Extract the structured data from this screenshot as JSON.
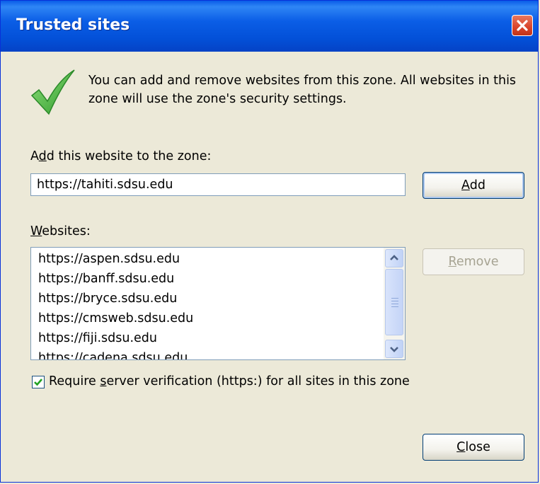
{
  "window": {
    "title": "Trusted sites"
  },
  "description": "You can add and remove websites from this zone. All websites in this zone will use the zone's security settings.",
  "add_section": {
    "label_pre": "A",
    "label_accel": "d",
    "label_post": "d this website to the zone:",
    "input_value": "https://tahiti.sdsu.edu",
    "add_button_accel": "A",
    "add_button_rest": "dd"
  },
  "websites_section": {
    "label_accel": "W",
    "label_rest": "ebsites:",
    "items": [
      "https://aspen.sdsu.edu",
      "https://banff.sdsu.edu",
      "https://bryce.sdsu.edu",
      "https://cmsweb.sdsu.edu",
      "https://fiji.sdsu.edu",
      "https://cadena.sdsu.edu"
    ],
    "remove_button_accel": "R",
    "remove_button_rest": "emove"
  },
  "verification": {
    "checked": true,
    "label_pre": "Require ",
    "label_accel": "s",
    "label_post": "erver verification (https:) for all sites in this zone"
  },
  "footer": {
    "close_button_accel": "C",
    "close_button_rest": "lose"
  },
  "icons": {
    "title_close": "close-icon",
    "zone_icon": "checkmark-icon",
    "scroll_up": "chevron-up-icon",
    "scroll_down": "chevron-down-icon",
    "checkbox": "checkbox-checked-icon"
  },
  "colors": {
    "titlebar": "#0a5ce8",
    "dialog_bg": "#ece9d8",
    "close_button": "#d9442b",
    "checkmark": "#3aa336"
  }
}
